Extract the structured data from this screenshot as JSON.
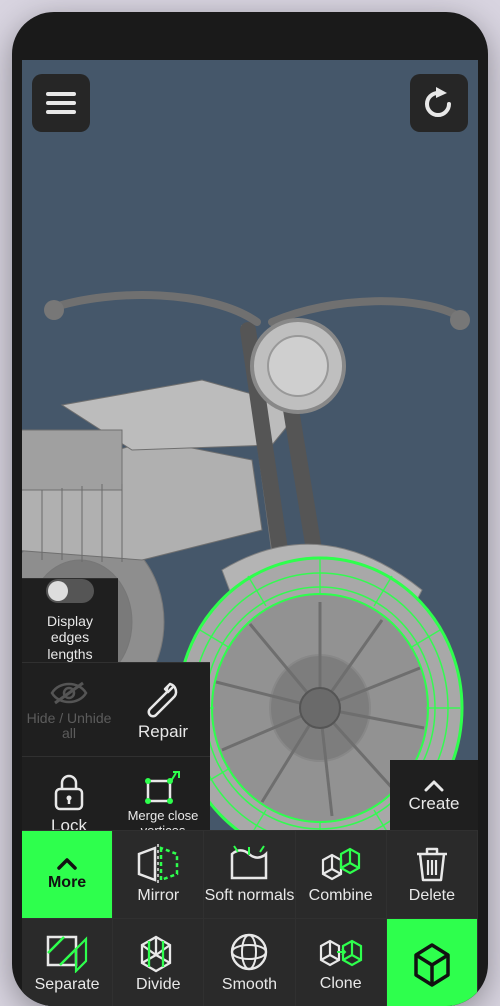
{
  "accent": "#2eff4d",
  "topbar": {
    "menu_icon": "hamburger",
    "undo_icon": "undo"
  },
  "viewport": {
    "model": "motorcycle-wireframe",
    "selection": "front-wheel",
    "selection_highlight_color": "#2eff4d"
  },
  "left_panel": {
    "display_edges_toggle": {
      "label": "Display edges lengths",
      "on": false
    },
    "hide_unhide": {
      "label": "Hide / Unhide all",
      "enabled": false
    },
    "repair": {
      "label": "Repair"
    },
    "lock": {
      "label": "Lock"
    },
    "merge_close": {
      "label": "Merge close vertices"
    }
  },
  "create_chip": {
    "label": "Create"
  },
  "tools": {
    "row1": [
      {
        "id": "more",
        "label": "More",
        "icon": "chevron-up",
        "active": true
      },
      {
        "id": "mirror",
        "label": "Mirror",
        "icon": "mirror"
      },
      {
        "id": "softnormals",
        "label": "Soft normals",
        "icon": "soft-normals"
      },
      {
        "id": "combine",
        "label": "Combine",
        "icon": "combine"
      },
      {
        "id": "delete",
        "label": "Delete",
        "icon": "trash"
      }
    ],
    "row2": [
      {
        "id": "separate",
        "label": "Separate",
        "icon": "separate"
      },
      {
        "id": "divide",
        "label": "Divide",
        "icon": "divide"
      },
      {
        "id": "smooth",
        "label": "Smooth",
        "icon": "smooth"
      },
      {
        "id": "clone",
        "label": "Clone",
        "icon": "clone"
      },
      {
        "id": "cube",
        "label": "",
        "icon": "cube-outline",
        "active": true
      }
    ]
  }
}
